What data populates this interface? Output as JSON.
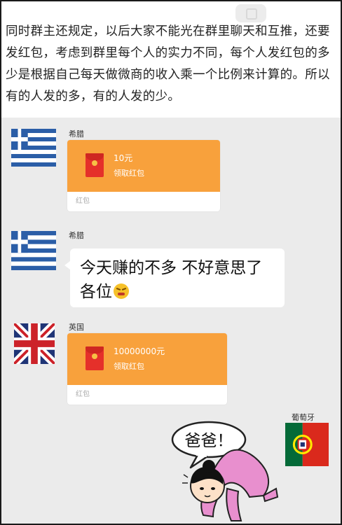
{
  "header": {
    "text": "同时群主还规定，以后大家不能光在群里聊天和互推，还要发红包，考虑到群里每个人的实力不同，每个人发红包的多少是根据自己每天做微商的收入乘一个比例来计算的。所以有的人发的多，有的人发的少。"
  },
  "messages": [
    {
      "sender": "希腊",
      "flag": "greece",
      "kind": "red_packet",
      "amount": "10元",
      "action": "领取红包",
      "type_label": "红包"
    },
    {
      "sender": "希腊",
      "flag": "greece",
      "kind": "text",
      "text": "今天赚的不多 不好意思了各位",
      "emoji": "angry-face-icon"
    },
    {
      "sender": "英国",
      "flag": "united-kingdom",
      "kind": "red_packet",
      "amount": "10000000元",
      "action": "领取红包",
      "type_label": "红包"
    },
    {
      "sender": "葡萄牙",
      "flag": "portugal",
      "kind": "sticker",
      "speech": "爸爸！"
    }
  ],
  "colors": {
    "packet_orange": "#f8a13c",
    "envelope_red": "#e5302a",
    "background": "#ebebeb",
    "greece_blue": "#2b5ea7",
    "uk_blue": "#1f3476",
    "uk_red": "#cc2229",
    "portugal_green": "#046a38",
    "portugal_red": "#da291c",
    "sticker_pink": "#e88fce"
  }
}
